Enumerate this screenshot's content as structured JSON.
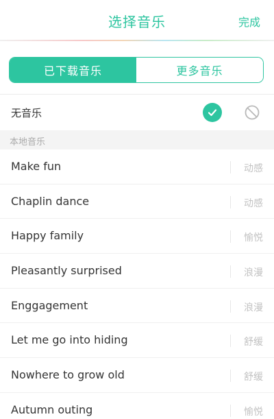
{
  "header": {
    "title": "选择音乐",
    "done_label": "完成"
  },
  "tabs": [
    {
      "label": "已下载音乐",
      "active": true
    },
    {
      "label": "更多音乐",
      "active": false
    }
  ],
  "no_music": {
    "label": "无音乐",
    "selected": true
  },
  "section": {
    "label": "本地音乐"
  },
  "songs": [
    {
      "name": "Make fun",
      "mood": "动感"
    },
    {
      "name": "Chaplin dance",
      "mood": "动感"
    },
    {
      "name": "Happy family",
      "mood": "愉悦"
    },
    {
      "name": "Pleasantly surprised",
      "mood": "浪漫"
    },
    {
      "name": "Enggagement",
      "mood": "浪漫"
    },
    {
      "name": "Let me go into hiding",
      "mood": "舒缓"
    },
    {
      "name": "Nowhere to grow old",
      "mood": "舒缓"
    },
    {
      "name": "Autumn outing",
      "mood": "愉悦"
    }
  ],
  "colors": {
    "accent": "#2dc5a0",
    "tag_text": "#c2c2c2",
    "section_bg": "#f4f4f4"
  }
}
